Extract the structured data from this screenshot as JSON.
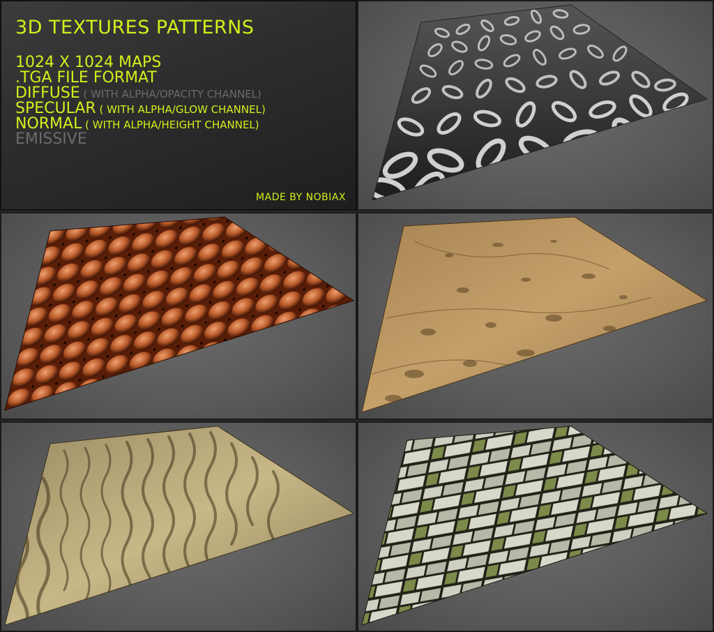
{
  "title": "3D TEXTURES PATTERNS",
  "specs": [
    {
      "main": "1024 X 1024 MAPS",
      "sub": "",
      "dim": false
    },
    {
      "main": ".TGA FILE FORMAT",
      "sub": "",
      "dim": false
    },
    {
      "main": "DIFFUSE",
      "sub": " ( WITH ALPHA/OPACITY CHANNEL)",
      "dim": false,
      "sub_dim": true
    },
    {
      "main": "SPECULAR",
      "sub": " ( WITH ALPHA/GLOW CHANNEL)",
      "dim": false
    },
    {
      "main": "NORMAL",
      "sub": " ( WITH ALPHA/HEIGHT CHANNEL)",
      "dim": false
    },
    {
      "main": "EMISSIVE",
      "sub": "",
      "dim": true
    }
  ],
  "credit": "MADE BY NOBIAX",
  "textures": [
    {
      "name": "chains",
      "color_base": "#3a3a3a",
      "color_hi": "#d8d8d8"
    },
    {
      "name": "tufted-leather",
      "color_base": "#7a3010",
      "color_hi": "#e8956a"
    },
    {
      "name": "mud",
      "color_base": "#8a6a3a",
      "color_hi": "#c9a46a"
    },
    {
      "name": "sand-ripples",
      "color_base": "#6a5a3a",
      "color_hi": "#d8c89a"
    },
    {
      "name": "stone-wall",
      "color_base": "#2a2a22",
      "color_hi": "#dcdcd0"
    }
  ],
  "colors": {
    "accent": "#d4ef1c",
    "dim_text": "#6b6b6b"
  }
}
